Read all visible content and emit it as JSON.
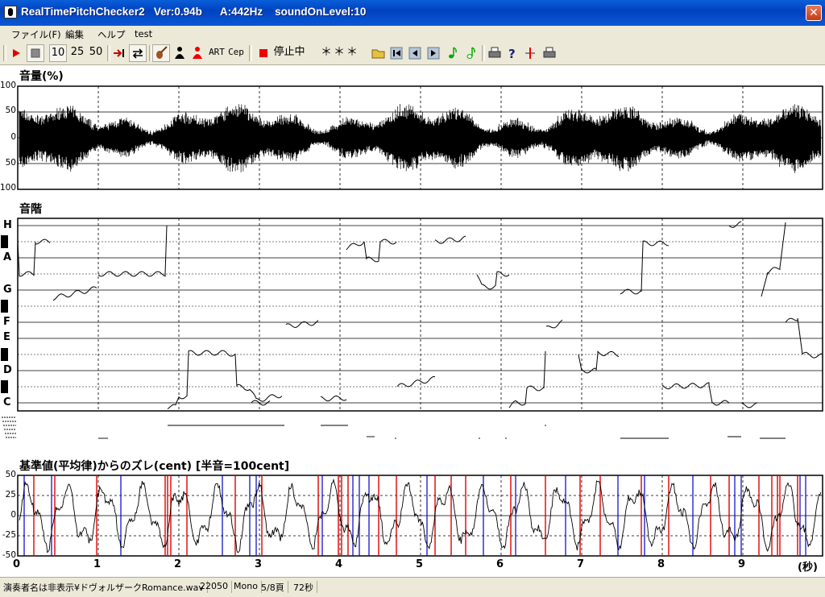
{
  "window": {
    "title": "RealTimePitchChecker2   Ver:0.94b      A:442Hz    soundOnLevel:10",
    "close_glyph": "✕"
  },
  "menu": [
    "ファイル(F)",
    "編集",
    "ヘルプ",
    "test"
  ],
  "toolbar": {
    "counts": [
      "10",
      "25",
      "50"
    ],
    "art_label": "ART",
    "cep_label": "Cep",
    "state_label": "停止中",
    "note_display": "＊＊＊",
    "icons": [
      "play-icon",
      "stop-icon",
      "jump-end-icon",
      "loop-icon",
      "violin-icon",
      "person-black-icon",
      "person-red-icon",
      "stop-red-icon",
      "folder-icon",
      "skip-start-icon",
      "prev-icon",
      "next-icon",
      "note-green-icon",
      "note-outline-icon",
      "print-icon",
      "help-icon",
      "split-icon",
      "print-alt-icon"
    ]
  },
  "volume_panel": {
    "label": "音量(%)",
    "ticks": [
      "100",
      "50",
      "0",
      "50",
      "100"
    ]
  },
  "scale_panel": {
    "label": "音階",
    "notes": [
      "H",
      "A",
      "G",
      "F",
      "E",
      "D",
      "C"
    ]
  },
  "deviation_panel": {
    "label": "基準値(平均律)からのズレ(cent) [半音=100cent]",
    "ticks": [
      "50",
      "25",
      "0",
      "-25",
      "-50"
    ]
  },
  "time_axis": {
    "labels": [
      "0",
      "1",
      "2",
      "3",
      "4",
      "5",
      "6",
      "7",
      "8",
      "9"
    ],
    "unit": "(秒)"
  },
  "statusbar": {
    "file": "演奏者名は非表示¥ドヴォルザークRomance.wav",
    "rate": "22050",
    "channel": "Mono",
    "page": "5/8頁",
    "duration": "72秒"
  }
}
